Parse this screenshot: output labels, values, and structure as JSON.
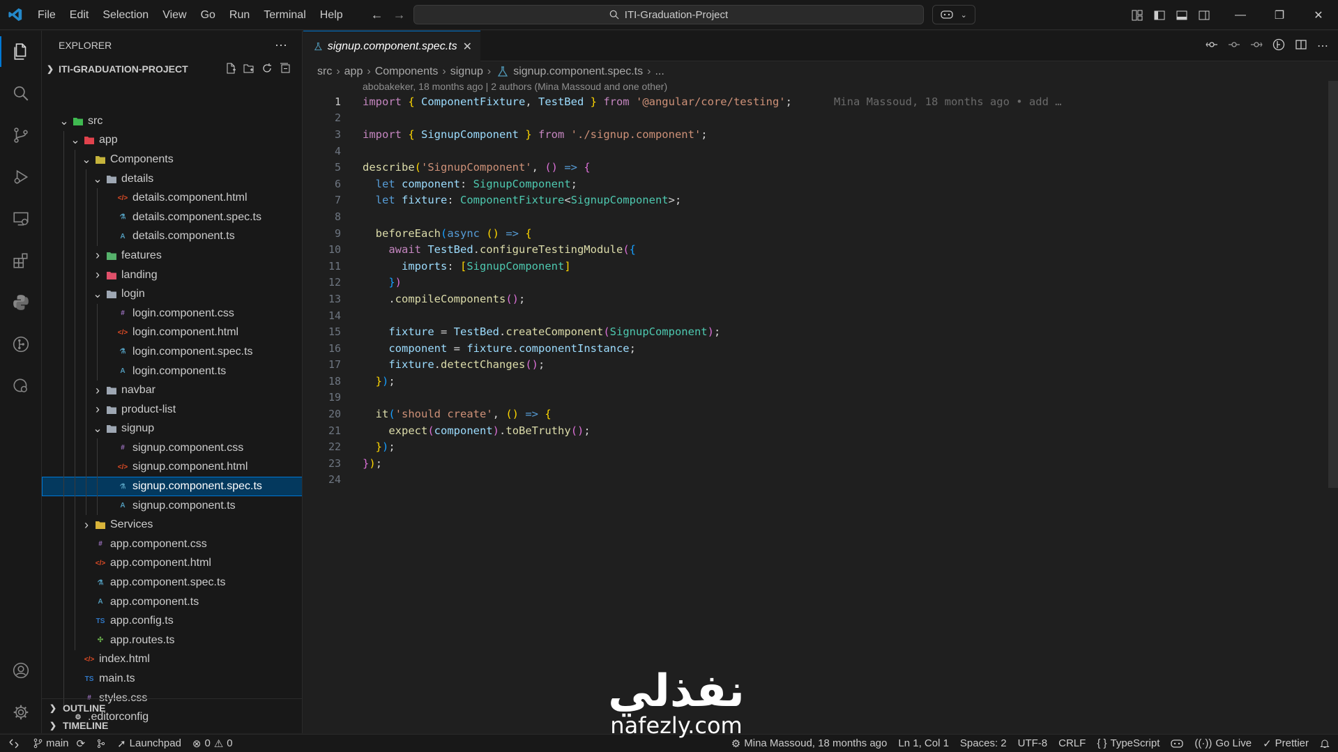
{
  "titlebar": {
    "menus": [
      "File",
      "Edit",
      "Selection",
      "View",
      "Go",
      "Run",
      "Terminal",
      "Help"
    ],
    "search_text": "ITI-Graduation-Project"
  },
  "sidebar": {
    "title": "EXPLORER",
    "project": "ITI-GRADUATION-PROJECT",
    "tree": [
      {
        "label": "src",
        "depth": 1,
        "kind": "folder-open",
        "icon_color": "#3fb950"
      },
      {
        "label": "app",
        "depth": 2,
        "kind": "folder-open",
        "icon_color": "#e0424c"
      },
      {
        "label": "Components",
        "depth": 3,
        "kind": "folder-open",
        "icon_color": "#c5b33b"
      },
      {
        "label": "details",
        "depth": 4,
        "kind": "folder-open",
        "icon_color": "#9ea7b3"
      },
      {
        "label": "details.component.html",
        "depth": 5,
        "kind": "html"
      },
      {
        "label": "details.component.spec.ts",
        "depth": 5,
        "kind": "spec"
      },
      {
        "label": "details.component.ts",
        "depth": 5,
        "kind": "ng"
      },
      {
        "label": "features",
        "depth": 4,
        "kind": "folder",
        "icon_color": "#56b16b"
      },
      {
        "label": "landing",
        "depth": 4,
        "kind": "folder",
        "icon_color": "#e0506a"
      },
      {
        "label": "login",
        "depth": 4,
        "kind": "folder-open",
        "icon_color": "#9ea7b3"
      },
      {
        "label": "login.component.css",
        "depth": 5,
        "kind": "css"
      },
      {
        "label": "login.component.html",
        "depth": 5,
        "kind": "html"
      },
      {
        "label": "login.component.spec.ts",
        "depth": 5,
        "kind": "spec"
      },
      {
        "label": "login.component.ts",
        "depth": 5,
        "kind": "ng"
      },
      {
        "label": "navbar",
        "depth": 4,
        "kind": "folder",
        "icon_color": "#9ea7b3"
      },
      {
        "label": "product-list",
        "depth": 4,
        "kind": "folder",
        "icon_color": "#9ea7b3"
      },
      {
        "label": "signup",
        "depth": 4,
        "kind": "folder-open",
        "icon_color": "#9ea7b3"
      },
      {
        "label": "signup.component.css",
        "depth": 5,
        "kind": "css"
      },
      {
        "label": "signup.component.html",
        "depth": 5,
        "kind": "html"
      },
      {
        "label": "signup.component.spec.ts",
        "depth": 5,
        "kind": "spec",
        "selected": true
      },
      {
        "label": "signup.component.ts",
        "depth": 5,
        "kind": "ng"
      },
      {
        "label": "Services",
        "depth": 3,
        "kind": "folder",
        "icon_color": "#d9b43a"
      },
      {
        "label": "app.component.css",
        "depth": 3,
        "kind": "css"
      },
      {
        "label": "app.component.html",
        "depth": 3,
        "kind": "html"
      },
      {
        "label": "app.component.spec.ts",
        "depth": 3,
        "kind": "spec"
      },
      {
        "label": "app.component.ts",
        "depth": 3,
        "kind": "ng"
      },
      {
        "label": "app.config.ts",
        "depth": 3,
        "kind": "ts"
      },
      {
        "label": "app.routes.ts",
        "depth": 3,
        "kind": "routes"
      },
      {
        "label": "index.html",
        "depth": 2,
        "kind": "html"
      },
      {
        "label": "main.ts",
        "depth": 2,
        "kind": "ts"
      },
      {
        "label": "styles.css",
        "depth": 2,
        "kind": "css"
      },
      {
        "label": ".editorconfig",
        "depth": 1,
        "kind": "config"
      }
    ],
    "sections": {
      "outline": "OUTLINE",
      "timeline": "TIMELINE"
    }
  },
  "editor": {
    "tab": "signup.component.spec.ts",
    "breadcrumb": [
      "src",
      "app",
      "Components",
      "signup",
      "signup.component.spec.ts",
      "..."
    ],
    "blame_header": "abobakeker, 18 months ago | 2 authors (Mina Massoud and one other)",
    "blame_inline": "Mina Massoud, 18 months ago • add …",
    "line_numbers": [
      "1",
      "2",
      "3",
      "4",
      "5",
      "6",
      "7",
      "8",
      "9",
      "10",
      "11",
      "12",
      "13",
      "14",
      "15",
      "16",
      "17",
      "18",
      "19",
      "20",
      "21",
      "22",
      "23",
      "24"
    ],
    "lines": [
      [
        [
          "c",
          "import "
        ],
        [
          "b1",
          "{ "
        ],
        [
          "v",
          "ComponentFixture"
        ],
        [
          "p",
          ", "
        ],
        [
          "v",
          "TestBed"
        ],
        [
          "b1",
          " }"
        ],
        [
          "c",
          " from "
        ],
        [
          "s",
          "'@angular/core/testing'"
        ],
        [
          "p",
          ";"
        ]
      ],
      [],
      [
        [
          "c",
          "import "
        ],
        [
          "b1",
          "{ "
        ],
        [
          "v",
          "SignupComponent"
        ],
        [
          "b1",
          " }"
        ],
        [
          "c",
          " from "
        ],
        [
          "s",
          "'./signup.component'"
        ],
        [
          "p",
          ";"
        ]
      ],
      [],
      [
        [
          "f",
          "describe"
        ],
        [
          "b1",
          "("
        ],
        [
          "s",
          "'SignupComponent'"
        ],
        [
          "p",
          ", "
        ],
        [
          "b2",
          "()"
        ],
        [
          "k",
          " => "
        ],
        [
          "b2",
          "{"
        ]
      ],
      [
        [
          "p",
          "  "
        ],
        [
          "k",
          "let "
        ],
        [
          "v",
          "component"
        ],
        [
          "p",
          ": "
        ],
        [
          "t",
          "SignupComponent"
        ],
        [
          "p",
          ";"
        ]
      ],
      [
        [
          "p",
          "  "
        ],
        [
          "k",
          "let "
        ],
        [
          "v",
          "fixture"
        ],
        [
          "p",
          ": "
        ],
        [
          "t",
          "ComponentFixture"
        ],
        [
          "p",
          "<"
        ],
        [
          "t",
          "SignupComponent"
        ],
        [
          "p",
          ">;"
        ]
      ],
      [],
      [
        [
          "p",
          "  "
        ],
        [
          "f",
          "beforeEach"
        ],
        [
          "b3",
          "("
        ],
        [
          "k",
          "async "
        ],
        [
          "b1",
          "()"
        ],
        [
          "k",
          " => "
        ],
        [
          "b1",
          "{"
        ]
      ],
      [
        [
          "p",
          "    "
        ],
        [
          "c",
          "await "
        ],
        [
          "v",
          "TestBed"
        ],
        [
          "p",
          "."
        ],
        [
          "f",
          "configureTestingModule"
        ],
        [
          "b2",
          "("
        ],
        [
          "b3",
          "{"
        ]
      ],
      [
        [
          "p",
          "      "
        ],
        [
          "v",
          "imports"
        ],
        [
          "p",
          ": "
        ],
        [
          "b1",
          "["
        ],
        [
          "t",
          "SignupComponent"
        ],
        [
          "b1",
          "]"
        ]
      ],
      [
        [
          "p",
          "    "
        ],
        [
          "b3",
          "}"
        ],
        [
          "b2",
          ")"
        ]
      ],
      [
        [
          "p",
          "    ."
        ],
        [
          "f",
          "compileComponents"
        ],
        [
          "b2",
          "()"
        ],
        [
          "p",
          ";"
        ]
      ],
      [],
      [
        [
          "p",
          "    "
        ],
        [
          "v",
          "fixture"
        ],
        [
          "p",
          " = "
        ],
        [
          "v",
          "TestBed"
        ],
        [
          "p",
          "."
        ],
        [
          "f",
          "createComponent"
        ],
        [
          "b2",
          "("
        ],
        [
          "t",
          "SignupComponent"
        ],
        [
          "b2",
          ")"
        ],
        [
          "p",
          ";"
        ]
      ],
      [
        [
          "p",
          "    "
        ],
        [
          "v",
          "component"
        ],
        [
          "p",
          " = "
        ],
        [
          "v",
          "fixture"
        ],
        [
          "p",
          "."
        ],
        [
          "v",
          "componentInstance"
        ],
        [
          "p",
          ";"
        ]
      ],
      [
        [
          "p",
          "    "
        ],
        [
          "v",
          "fixture"
        ],
        [
          "p",
          "."
        ],
        [
          "f",
          "detectChanges"
        ],
        [
          "b2",
          "()"
        ],
        [
          "p",
          ";"
        ]
      ],
      [
        [
          "p",
          "  "
        ],
        [
          "b1",
          "}"
        ],
        [
          "b3",
          ")"
        ],
        [
          "p",
          ";"
        ]
      ],
      [],
      [
        [
          "p",
          "  "
        ],
        [
          "f",
          "it"
        ],
        [
          "b3",
          "("
        ],
        [
          "s",
          "'should create'"
        ],
        [
          "p",
          ", "
        ],
        [
          "b1",
          "()"
        ],
        [
          "k",
          " => "
        ],
        [
          "b1",
          "{"
        ]
      ],
      [
        [
          "p",
          "    "
        ],
        [
          "f",
          "expect"
        ],
        [
          "b2",
          "("
        ],
        [
          "v",
          "component"
        ],
        [
          "b2",
          ")"
        ],
        [
          "p",
          "."
        ],
        [
          "f",
          "toBeTruthy"
        ],
        [
          "b2",
          "()"
        ],
        [
          "p",
          ";"
        ]
      ],
      [
        [
          "p",
          "  "
        ],
        [
          "b1",
          "}"
        ],
        [
          "b3",
          ")"
        ],
        [
          "p",
          ";"
        ]
      ],
      [
        [
          "b2",
          "}"
        ],
        [
          "b1",
          ")"
        ],
        [
          "p",
          ";"
        ]
      ],
      []
    ]
  },
  "statusbar": {
    "branch": "main",
    "launchpad": "Launchpad",
    "errors": "0",
    "warnings": "0",
    "blame": "Mina Massoud, 18 months ago",
    "position": "Ln 1, Col 1",
    "spaces": "Spaces: 2",
    "encoding": "UTF-8",
    "eol": "CRLF",
    "language": "TypeScript",
    "golive": "Go Live",
    "prettier": "Prettier"
  },
  "watermark": {
    "arabic": "نفذلي",
    "latin": "nafezly.com"
  }
}
